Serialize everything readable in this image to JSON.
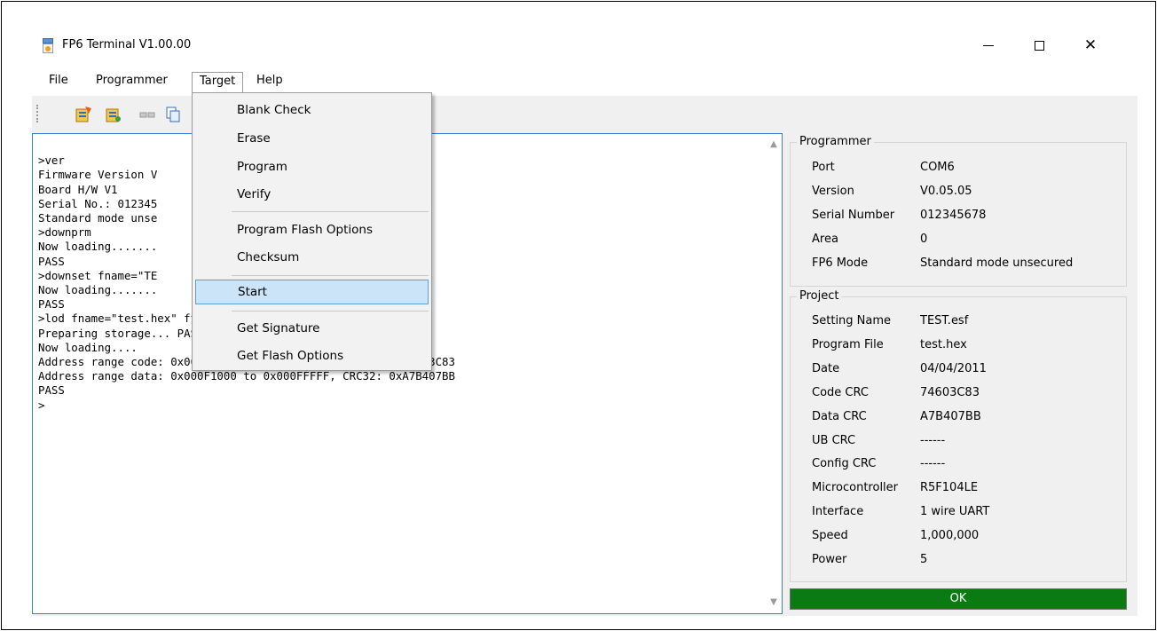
{
  "window": {
    "title": "FP6 Terminal V1.00.00"
  },
  "menubar": {
    "file": "File",
    "programmer": "Programmer",
    "target": "Target",
    "help": "Help"
  },
  "target_menu": {
    "items": [
      "Blank Check",
      "Erase",
      "Program",
      "Verify",
      "Program Flash Options",
      "Checksum",
      "Start",
      "Get Signature",
      "Get Flash Options"
    ],
    "highlighted": "Start"
  },
  "console": {
    "lines": [
      "",
      ">ver",
      "Firmware Version V",
      "Board H/W V1",
      "Serial No.: 012345",
      "Standard mode unse",
      ">downprm",
      "Now loading.......",
      "PASS",
      ">downset fname=\"TE",
      "Now loading.......",
      "PASS",
      ">lod fname=\"test.hex\" ftime=\"2011-04-04 14:40\"",
      "Preparing storage... PASS",
      "Now loading....",
      "Address range code: 0x00000000 to 0x0007FFFF, CRC32: 0x74603C83",
      "Address range data: 0x000F1000 to 0x000FFFFF, CRC32: 0xA7B407BB",
      "PASS",
      ">"
    ]
  },
  "programmer": {
    "title": "Programmer",
    "rows": [
      {
        "key": "Port",
        "value": "COM6"
      },
      {
        "key": "Version",
        "value": "V0.05.05"
      },
      {
        "key": "Serial Number",
        "value": "012345678"
      },
      {
        "key": "Area",
        "value": "0"
      },
      {
        "key": "FP6 Mode",
        "value": "Standard mode unsecured"
      }
    ]
  },
  "project": {
    "title": "Project",
    "rows": [
      {
        "key": "Setting Name",
        "value": "TEST.esf"
      },
      {
        "key": "Program File",
        "value": "test.hex"
      },
      {
        "key": "Date",
        "value": "04/04/2011"
      },
      {
        "key": "Code CRC",
        "value": "74603C83"
      },
      {
        "key": "Data CRC",
        "value": "A7B407BB"
      },
      {
        "key": "UB CRC",
        "value": "------"
      },
      {
        "key": "Config CRC",
        "value": "------"
      },
      {
        "key": "Microcontroller",
        "value": "R5F104LE"
      },
      {
        "key": "Interface",
        "value": "1 wire UART"
      },
      {
        "key": "Speed",
        "value": "1,000,000"
      },
      {
        "key": "Power",
        "value": "5"
      }
    ]
  },
  "status": {
    "text": "OK",
    "color": "#0a7b12"
  }
}
